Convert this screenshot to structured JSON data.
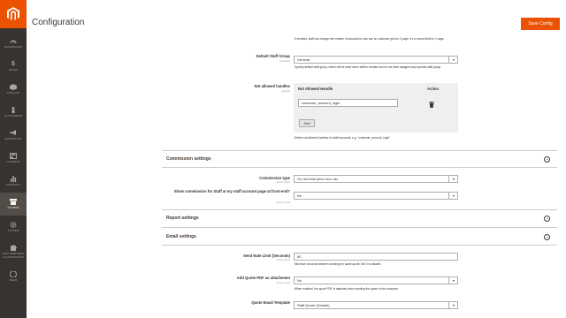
{
  "page": {
    "title": "Configuration",
    "save_label": "Save Config"
  },
  "sidebar": {
    "items": [
      {
        "label": "DASHBOARD",
        "icon": "dashboard-icon"
      },
      {
        "label": "SALES",
        "icon": "dollar-icon"
      },
      {
        "label": "CATALOG",
        "icon": "box-icon"
      },
      {
        "label": "CUSTOMERS",
        "icon": "user-icon"
      },
      {
        "label": "MARKETING",
        "icon": "megaphone-icon"
      },
      {
        "label": "CONTENT",
        "icon": "layout-icon"
      },
      {
        "label": "REPORTS",
        "icon": "bar-chart-icon"
      },
      {
        "label": "STORES",
        "icon": "store-icon"
      },
      {
        "label": "SYSTEM",
        "icon": "gear-icon"
      },
      {
        "label": "FIND PARTNERS & EXTENSIONS",
        "icon": "puzzle-icon"
      },
      {
        "label": "DEAR",
        "icon": "hexagon-icon"
      }
    ]
  },
  "staff": {
    "top_note": "If enabled, staff can change the number of seconds he can see on customer grid on 1 page. It's a record limit for 1 page.",
    "default_group": {
      "label": "Default Staff Group",
      "scope": "[website]",
      "value": "General",
      "note": "Specify default staff group, which will be used when staff is created and do not have assigned any specific staff group."
    },
    "not_allowed": {
      "label": "Not allowed handles",
      "scope": "[global]",
      "col_handle": "Not Allowed Handle",
      "col_action": "Action",
      "row_value": "customer_account_login",
      "add_label": "Add",
      "note": "Define not allowed handles for staff accounts, e.g. \"customer_account_login\""
    }
  },
  "commission": {
    "title": "Commission settings",
    "type": {
      "label": "Commission type",
      "scope": "[store view]",
      "value": "On net total price excl. tax"
    },
    "show": {
      "label": "Show commission for Staff at my staff account page at front-end?",
      "scope": "[store view]",
      "value": "No"
    }
  },
  "report": {
    "title": "Report settings"
  },
  "email": {
    "title": "Email settings",
    "rate": {
      "label": "Send Rate Limit (Seconds)",
      "scope": "[store view]",
      "value": "60",
      "note": "Minimum seconds between sending the same quote. Set 0 to disable."
    },
    "pdf": {
      "label": "Add Quote PDF as attachment",
      "scope": "[store view]",
      "value": "No",
      "note": "When enabled, the quote PDF is attached when sending the quote to the customer."
    },
    "template": {
      "label": "Quote Email Template",
      "value": "Staff Quote (Default)"
    }
  }
}
